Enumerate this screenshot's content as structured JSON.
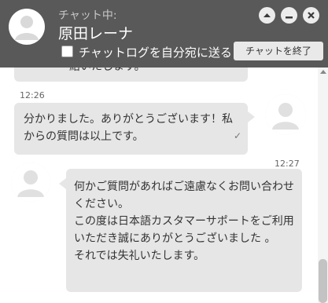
{
  "header": {
    "status": "チャット中:",
    "agent_name": "原田レーナ",
    "send_log_label": "チャットログを自分宛に送る",
    "send_log_checked": false,
    "end_chat_label": "チャットを終了",
    "controls": [
      "chevron-up-icon",
      "minimize-icon",
      "close-icon"
    ]
  },
  "messages": [
    {
      "sender": "agent",
      "text": "結いたします。",
      "partial": true
    },
    {
      "sender": "user",
      "time": "12:26",
      "text": "分かりました。ありがとうございます！私からの質問は以上です。",
      "read": "✓"
    },
    {
      "sender": "agent",
      "time": "12:27",
      "lines": [
        "何かご質問があればご遠慮なくお問い合わせください。",
        "この度は日本語カスタマーサポートをご利用いただき誠にありがとうございました 。",
        "それでは失礼いたします。"
      ]
    }
  ],
  "colors": {
    "header_bg": "#595959",
    "bubble_bg": "#e6e6e6",
    "control_bg": "#ececec"
  }
}
